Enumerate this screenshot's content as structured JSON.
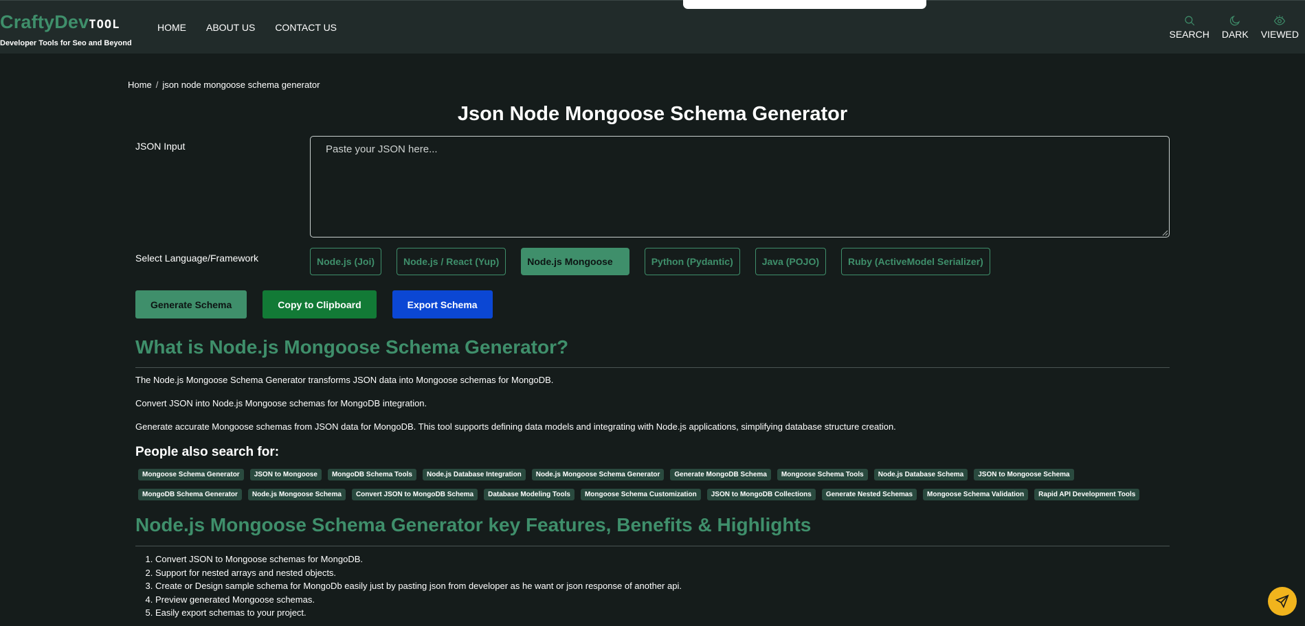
{
  "header": {
    "logo_main": "CraftyDev",
    "logo_tool": "TOOL",
    "logo_sub": "Developer Tools for Seo and Beyond",
    "nav": [
      "HOME",
      "ABOUT US",
      "CONTACT US"
    ],
    "actions": [
      {
        "label": "SEARCH",
        "icon": "search-icon"
      },
      {
        "label": "DARK",
        "icon": "moon-icon"
      },
      {
        "label": "VIEWED",
        "icon": "eye-icon"
      }
    ]
  },
  "breadcrumb": {
    "home": "Home",
    "separator": "/",
    "current": "json node mongoose schema generator"
  },
  "page_title": "Json Node Mongoose Schema Generator",
  "json_input": {
    "label": "JSON Input",
    "placeholder": "Paste your JSON here...",
    "value": ""
  },
  "framework": {
    "label": "Select Language/Framework",
    "options": [
      {
        "label": "Node.js (Joi)",
        "active": false
      },
      {
        "label": "Node.js / React (Yup)",
        "active": false
      },
      {
        "label": "Node.js Mongoose",
        "active": true
      },
      {
        "label": "Python (Pydantic)",
        "active": false
      },
      {
        "label": "Java (POJO)",
        "active": false
      },
      {
        "label": "Ruby (ActiveModel Serializer)",
        "active": false
      }
    ]
  },
  "actions": {
    "generate": "Generate Schema",
    "copy": "Copy to Clipboard",
    "export": "Export Schema"
  },
  "about": {
    "heading": "What is Node.js Mongoose Schema Generator?",
    "paragraphs": [
      "The Node.js Mongoose Schema Generator transforms JSON data into Mongoose schemas for MongoDB.",
      "Convert JSON into Node.js Mongoose schemas for MongoDB integration.",
      "Generate accurate Mongoose schemas from JSON data for MongoDB. This tool supports defining data models and integrating with Node.js applications, simplifying database structure creation."
    ]
  },
  "people_search": {
    "heading": "People also search for:",
    "tags": [
      "Mongoose Schema Generator",
      "JSON to Mongoose",
      "MongoDB Schema Tools",
      "Node.js Database Integration",
      "Node.js Mongoose Schema Generator",
      "Generate MongoDB Schema",
      "Mongoose Schema Tools",
      "Node.js Database Schema",
      "JSON to Mongoose Schema",
      "MongoDB Schema Generator",
      "Node.js Mongoose Schema",
      "Convert JSON to MongoDB Schema",
      "Database Modeling Tools",
      "Mongoose Schema Customization",
      "JSON to MongoDB Collections",
      "Generate Nested Schemas",
      "Mongoose Schema Validation",
      "Rapid API Development Tools"
    ]
  },
  "features": {
    "heading": "Node.js Mongoose Schema Generator key Features, Benefits & Highlights",
    "items": [
      "Convert JSON to Mongoose schemas for MongoDB.",
      "Support for nested arrays and nested objects.",
      "Create or Design sample schema for MongoDb easily just by pasting json from developer as he want or json response of another api.",
      "Preview generated Mongoose schemas.",
      "Easily export schemas to your project."
    ]
  },
  "colors": {
    "background": "#151c1b",
    "header": "#212b2a",
    "accent": "#3f8f6b",
    "copy_button": "#127a36",
    "export_button": "#0b47d4",
    "fab": "#f1b41d"
  },
  "fab_icon": "send-icon"
}
